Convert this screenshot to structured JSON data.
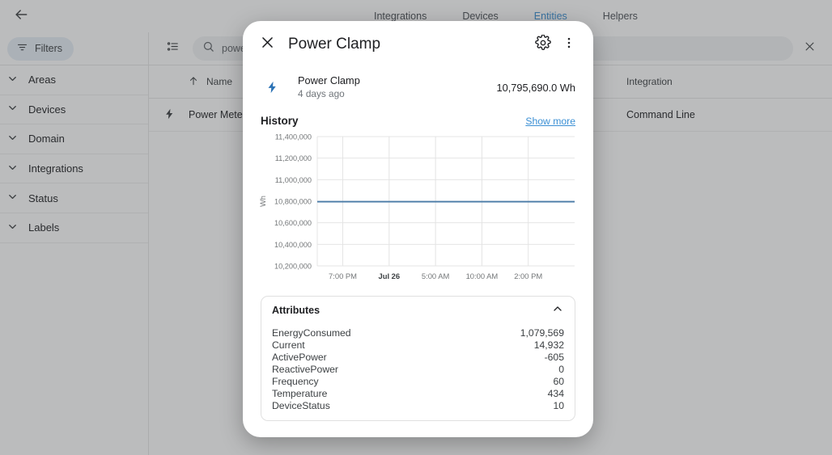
{
  "topbar": {
    "back_icon": "arrow-left-icon",
    "tabs": [
      {
        "label": "Integrations",
        "active": false
      },
      {
        "label": "Devices",
        "active": false
      },
      {
        "label": "Entities",
        "active": true
      },
      {
        "label": "Helpers",
        "active": false
      }
    ]
  },
  "toolbar": {
    "settings_icon": "list-settings-icon",
    "search_icon": "search-icon",
    "search_value": "power",
    "clear_icon": "close-icon"
  },
  "sidebar": {
    "filters_label": "Filters",
    "filters_icon": "filter-icon",
    "items": [
      {
        "label": "Areas"
      },
      {
        "label": "Devices"
      },
      {
        "label": "Domain"
      },
      {
        "label": "Integrations"
      },
      {
        "label": "Status"
      },
      {
        "label": "Labels"
      }
    ]
  },
  "table": {
    "columns": {
      "name": "Name",
      "integration": "Integration"
    },
    "sort_icon": "arrow-up-icon",
    "rows": [
      {
        "icon": "lightning-bolt-icon",
        "name": "Power Meter",
        "integration": "Command Line"
      }
    ]
  },
  "dialog": {
    "close_icon": "close-icon",
    "title": "Power Clamp",
    "settings_icon": "gear-icon",
    "menu_icon": "more-vert-icon",
    "entity": {
      "icon": "lightning-bolt-icon",
      "name": "Power Clamp",
      "last_changed": "4 days ago",
      "state": "10,795,690.0 Wh"
    },
    "history": {
      "title": "History",
      "show_more": "Show more"
    },
    "attributes": {
      "title": "Attributes",
      "collapse_icon": "chevron-up-icon",
      "rows": [
        {
          "key": "EnergyConsumed",
          "value": "1,079,569"
        },
        {
          "key": "Current",
          "value": "14,932"
        },
        {
          "key": "ActivePower",
          "value": "-605"
        },
        {
          "key": "ReactivePower",
          "value": "0"
        },
        {
          "key": "Frequency",
          "value": "60"
        },
        {
          "key": "Temperature",
          "value": "434"
        },
        {
          "key": "DeviceStatus",
          "value": "10"
        }
      ]
    }
  },
  "colors": {
    "accent": "#3a8fd4",
    "line": "#4a7ba7",
    "bolt": "#2b72b5",
    "overlay": "#aaaaaa"
  },
  "chart_data": {
    "type": "line",
    "title": "History",
    "xlabel": "",
    "ylabel": "Wh",
    "ylim": [
      10200000,
      11400000
    ],
    "ytick_labels": [
      "11,400,000",
      "11,200,000",
      "11,000,000",
      "10,800,000",
      "10,600,000",
      "10,400,000",
      "10,200,000"
    ],
    "yticks": [
      11400000,
      11200000,
      11000000,
      10800000,
      10600000,
      10400000,
      10200000
    ],
    "xtick_labels": [
      "7:00 PM",
      "Jul 26",
      "5:00 AM",
      "10:00 AM",
      "2:00 PM"
    ],
    "xtick_bold": [
      false,
      true,
      false,
      false,
      false
    ],
    "grid": true,
    "legend": "none",
    "series": [
      {
        "name": "Power Clamp",
        "color": "#4a7ba7",
        "x": [
          "7:00 PM",
          "Jul 26",
          "5:00 AM",
          "10:00 AM",
          "2:00 PM"
        ],
        "values": [
          10795690,
          10795690,
          10795690,
          10795690,
          10795690
        ]
      }
    ]
  }
}
